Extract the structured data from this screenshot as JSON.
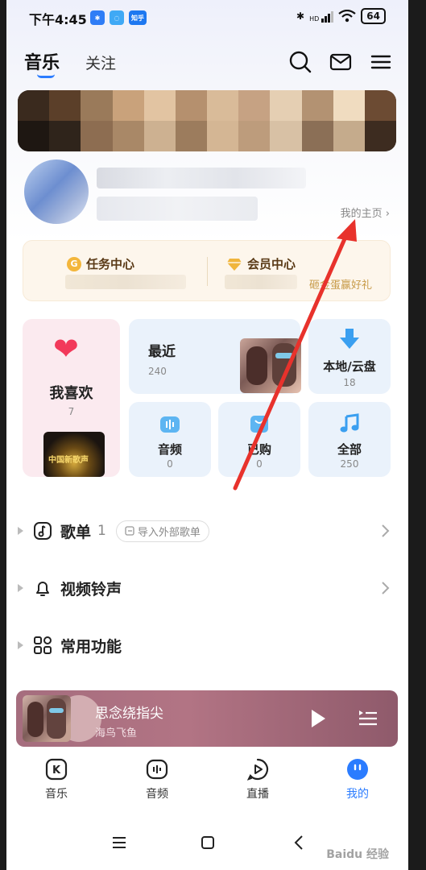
{
  "status_bar": {
    "time": "下午4:45",
    "app_icons": [
      "bluetooth-app-icon",
      "chat-app-icon",
      "zhihu-icon"
    ],
    "zhihu_label": "知乎",
    "network": "HD",
    "battery": "64"
  },
  "header": {
    "tab_music": "音乐",
    "tab_follow": "关注",
    "icons": [
      "search-icon",
      "mail-icon",
      "menu-icon"
    ]
  },
  "profile": {
    "home_link": "我的主页 ›"
  },
  "task_card": {
    "task_center": "任务中心",
    "vip_center": "会员中心",
    "vip_promo": "砸金蛋赢好礼"
  },
  "grid": {
    "favorites": {
      "title": "我喜欢",
      "count": "7",
      "album_text": "中国新歌声"
    },
    "recent": {
      "title": "最近",
      "count": "240"
    },
    "local": {
      "title": "本地/云盘",
      "count": "18"
    },
    "audio": {
      "title": "音频",
      "count": "0"
    },
    "purchased": {
      "title": "已购",
      "count": "0"
    },
    "all": {
      "title": "全部",
      "count": "250"
    }
  },
  "sections": {
    "playlist": {
      "label": "歌单",
      "count": "1",
      "import": "导入外部歌单"
    },
    "ringtone": {
      "label": "视频铃声"
    },
    "common": {
      "label": "常用功能"
    }
  },
  "player": {
    "title": "思念绕指尖",
    "artist": "海鸟飞鱼"
  },
  "bottom_nav": {
    "items": [
      {
        "label": "音乐"
      },
      {
        "label": "音频"
      },
      {
        "label": "直播"
      },
      {
        "label": "我的"
      }
    ],
    "active_index": 3
  },
  "watermark": "Baidu 经验",
  "colors": {
    "accent": "#2b7cff",
    "heart": "#f2395a",
    "annotation": "#e8322c",
    "player_bg": "#a56d7e"
  }
}
